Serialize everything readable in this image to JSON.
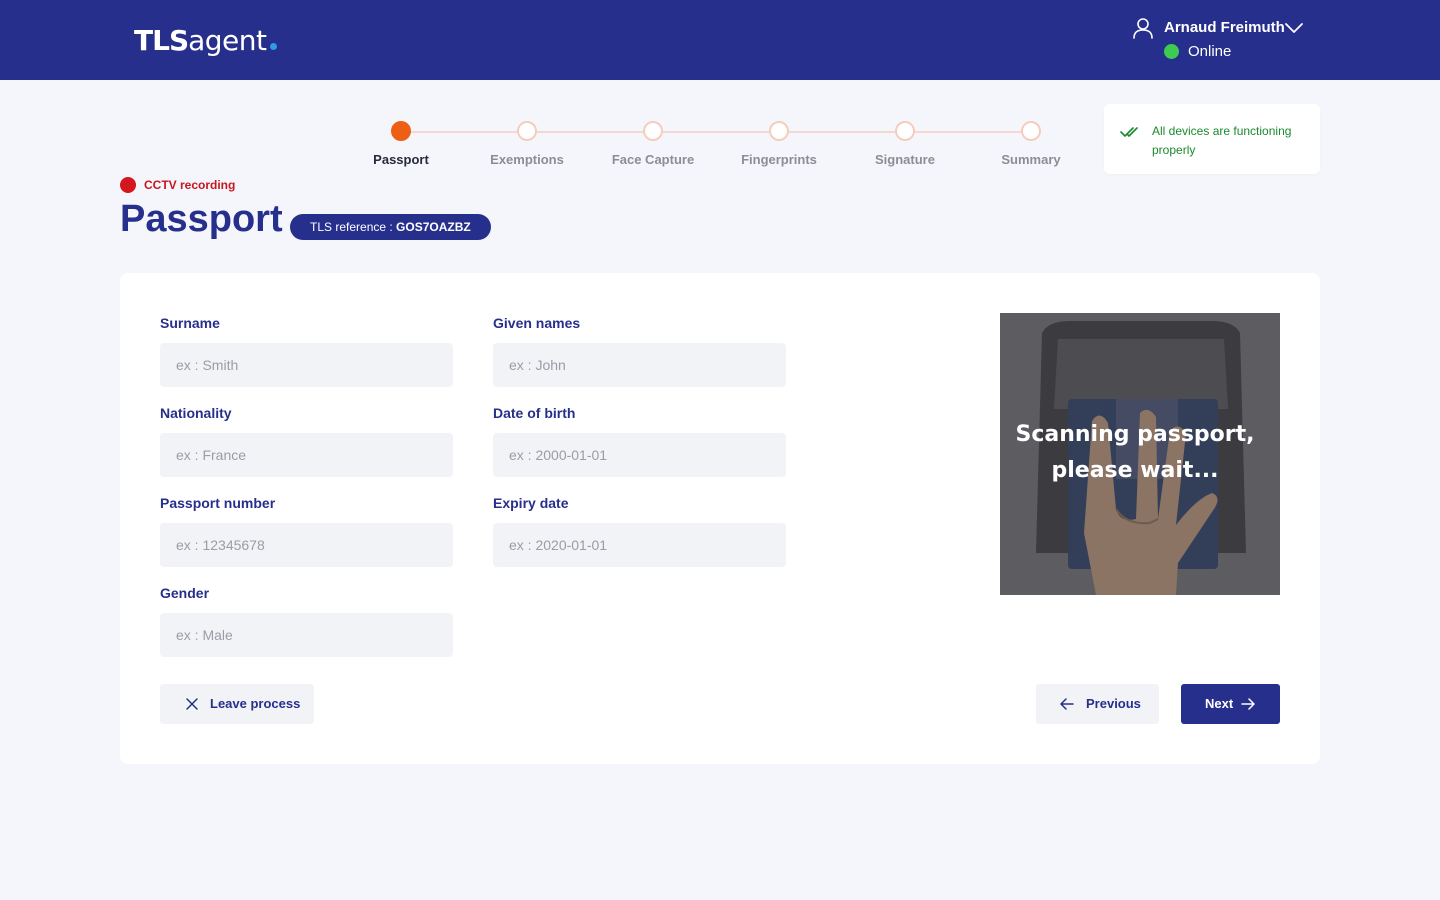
{
  "header": {
    "logo_bold": "TLS",
    "logo_light": "agent",
    "user_name": "Arnaud Freimuth",
    "status": "Online",
    "colors": {
      "background": "#272f8d",
      "status": "#3dcb52",
      "logo_dot": "#2f9be6"
    }
  },
  "stepper": {
    "steps": [
      {
        "label": "Passport",
        "active": true
      },
      {
        "label": "Exemptions",
        "active": false
      },
      {
        "label": "Face Capture",
        "active": false
      },
      {
        "label": "Fingerprints",
        "active": false
      },
      {
        "label": "Signature",
        "active": false
      },
      {
        "label": "Summary",
        "active": false
      }
    ],
    "colors": {
      "active": "#ec5f15",
      "inactive": "#f6cdbd"
    }
  },
  "device_status": {
    "text": "All devices are functioning properly",
    "icon": "double-check-icon",
    "color": "#198a2e"
  },
  "cctv": {
    "text": "CCTV recording",
    "color": "#d3161f"
  },
  "page": {
    "title": "Passport",
    "reference_label": "TLS reference : ",
    "reference_value": "GOS7OAZBZ"
  },
  "form": {
    "surname": {
      "label": "Surname",
      "placeholder": "ex : Smith",
      "value": ""
    },
    "given_names": {
      "label": "Given names",
      "placeholder": "ex : John",
      "value": ""
    },
    "nationality": {
      "label": "Nationality",
      "placeholder": "ex : France",
      "value": ""
    },
    "date_of_birth": {
      "label": "Date of birth",
      "placeholder": "ex : 2000-01-01",
      "value": ""
    },
    "passport_number": {
      "label": "Passport number",
      "placeholder": "ex : 12345678",
      "value": ""
    },
    "expiry_date": {
      "label": "Expiry date",
      "placeholder": "ex : 2020-01-01",
      "value": ""
    },
    "gender": {
      "label": "Gender",
      "placeholder": "ex : Male",
      "value": ""
    }
  },
  "scan": {
    "line1": "Scanning passport,",
    "line2": "please wait..."
  },
  "buttons": {
    "leave": "Leave process",
    "previous": "Previous",
    "next": "Next"
  }
}
